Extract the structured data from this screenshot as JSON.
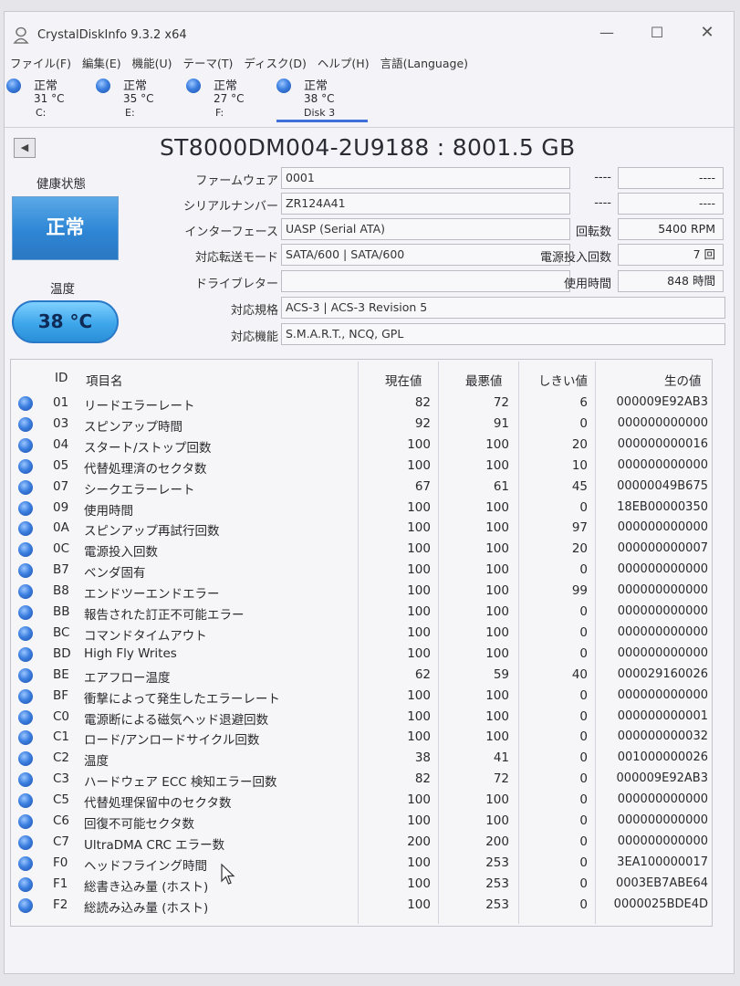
{
  "window": {
    "title": "CrystalDiskInfo 9.3.2 x64",
    "minimize": "—",
    "maximize": "☐",
    "close": "✕"
  },
  "menu": [
    "ファイル(F)",
    "編集(E)",
    "機能(U)",
    "テーマ(T)",
    "ディスク(D)",
    "ヘルプ(H)",
    "言語(Language)"
  ],
  "disks": [
    {
      "status": "正常",
      "temp": "31 °C",
      "letter": "C:"
    },
    {
      "status": "正常",
      "temp": "35 °C",
      "letter": "E:"
    },
    {
      "status": "正常",
      "temp": "27 °C",
      "letter": "F:"
    },
    {
      "status": "正常",
      "temp": "38 °C",
      "letter": "Disk 3"
    }
  ],
  "drive": {
    "title": "ST8000DM004-2U9188 : 8001.5 GB",
    "health_label": "健康状態",
    "health": "正常",
    "temp_label": "温度",
    "temp": "38 °C",
    "firmware_label": "ファームウェア",
    "firmware": "0001",
    "serial_label": "シリアルナンバー",
    "serial": "ZR124A41",
    "interface_label": "インターフェース",
    "interface": "UASP (Serial ATA)",
    "transfer_label": "対応転送モード",
    "transfer": "SATA/600 | SATA/600",
    "letter_label": "ドライブレター",
    "letter": "",
    "standard_label": "対応規格",
    "standard": "ACS-3 | ACS-3 Revision 5",
    "features_label": "対応機能",
    "features": "S.M.A.R.T., NCQ, GPL",
    "right_blank_label_1": "----",
    "right_blank_val_1": "----",
    "right_blank_label_2": "----",
    "right_blank_val_2": "----",
    "rotation_label": "回転数",
    "rotation": "5400 RPM",
    "power_on_count_label": "電源投入回数",
    "power_on_count": "7 回",
    "power_on_hours_label": "使用時間",
    "power_on_hours": "848 時間"
  },
  "smart": {
    "headers": {
      "id": "ID",
      "name": "項目名",
      "current": "現在値",
      "worst": "最悪値",
      "threshold": "しきい値",
      "raw": "生の値"
    },
    "rows": [
      {
        "id": "01",
        "name": "リードエラーレート",
        "current": "82",
        "worst": "72",
        "threshold": "6",
        "raw": "000009E92AB3"
      },
      {
        "id": "03",
        "name": "スピンアップ時間",
        "current": "92",
        "worst": "91",
        "threshold": "0",
        "raw": "000000000000"
      },
      {
        "id": "04",
        "name": "スタート/ストップ回数",
        "current": "100",
        "worst": "100",
        "threshold": "20",
        "raw": "000000000016"
      },
      {
        "id": "05",
        "name": "代替処理済のセクタ数",
        "current": "100",
        "worst": "100",
        "threshold": "10",
        "raw": "000000000000"
      },
      {
        "id": "07",
        "name": "シークエラーレート",
        "current": "67",
        "worst": "61",
        "threshold": "45",
        "raw": "00000049B675"
      },
      {
        "id": "09",
        "name": "使用時間",
        "current": "100",
        "worst": "100",
        "threshold": "0",
        "raw": "18EB00000350"
      },
      {
        "id": "0A",
        "name": "スピンアップ再試行回数",
        "current": "100",
        "worst": "100",
        "threshold": "97",
        "raw": "000000000000"
      },
      {
        "id": "0C",
        "name": "電源投入回数",
        "current": "100",
        "worst": "100",
        "threshold": "20",
        "raw": "000000000007"
      },
      {
        "id": "B7",
        "name": "ベンダ固有",
        "current": "100",
        "worst": "100",
        "threshold": "0",
        "raw": "000000000000"
      },
      {
        "id": "B8",
        "name": "エンドツーエンドエラー",
        "current": "100",
        "worst": "100",
        "threshold": "99",
        "raw": "000000000000"
      },
      {
        "id": "BB",
        "name": "報告された訂正不可能エラー",
        "current": "100",
        "worst": "100",
        "threshold": "0",
        "raw": "000000000000"
      },
      {
        "id": "BC",
        "name": "コマンドタイムアウト",
        "current": "100",
        "worst": "100",
        "threshold": "0",
        "raw": "000000000000"
      },
      {
        "id": "BD",
        "name": "High Fly Writes",
        "current": "100",
        "worst": "100",
        "threshold": "0",
        "raw": "000000000000"
      },
      {
        "id": "BE",
        "name": "エアフロー温度",
        "current": "62",
        "worst": "59",
        "threshold": "40",
        "raw": "000029160026"
      },
      {
        "id": "BF",
        "name": "衝撃によって発生したエラーレート",
        "current": "100",
        "worst": "100",
        "threshold": "0",
        "raw": "000000000000"
      },
      {
        "id": "C0",
        "name": "電源断による磁気ヘッド退避回数",
        "current": "100",
        "worst": "100",
        "threshold": "0",
        "raw": "000000000001"
      },
      {
        "id": "C1",
        "name": "ロード/アンロードサイクル回数",
        "current": "100",
        "worst": "100",
        "threshold": "0",
        "raw": "000000000032"
      },
      {
        "id": "C2",
        "name": "温度",
        "current": "38",
        "worst": "41",
        "threshold": "0",
        "raw": "001000000026"
      },
      {
        "id": "C3",
        "name": "ハードウェア ECC 検知エラー回数",
        "current": "82",
        "worst": "72",
        "threshold": "0",
        "raw": "000009E92AB3"
      },
      {
        "id": "C5",
        "name": "代替処理保留中のセクタ数",
        "current": "100",
        "worst": "100",
        "threshold": "0",
        "raw": "000000000000"
      },
      {
        "id": "C6",
        "name": "回復不可能セクタ数",
        "current": "100",
        "worst": "100",
        "threshold": "0",
        "raw": "000000000000"
      },
      {
        "id": "C7",
        "name": "UltraDMA CRC エラー数",
        "current": "200",
        "worst": "200",
        "threshold": "0",
        "raw": "000000000000"
      },
      {
        "id": "F0",
        "name": "ヘッドフライング時間",
        "current": "100",
        "worst": "253",
        "threshold": "0",
        "raw": "3EA100000017"
      },
      {
        "id": "F1",
        "name": "総書き込み量 (ホスト)",
        "current": "100",
        "worst": "253",
        "threshold": "0",
        "raw": "0003EB7ABE64"
      },
      {
        "id": "F2",
        "name": "総読み込み量 (ホスト)",
        "current": "100",
        "worst": "253",
        "threshold": "0",
        "raw": "0000025BDE4D"
      }
    ]
  }
}
